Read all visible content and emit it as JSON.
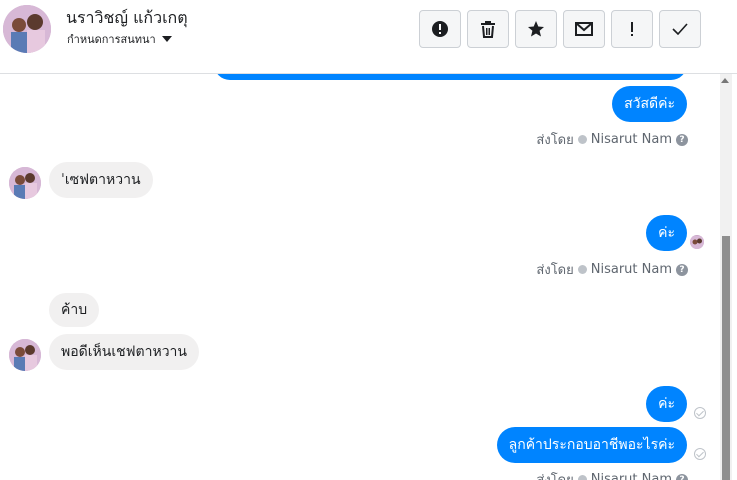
{
  "header": {
    "contact_name": "นราวิชญ์ แก้วเกตุ",
    "label_dropdown": "กำหนดการสนทนา"
  },
  "toolbar": {
    "buttons": [
      "report-icon",
      "trash-icon",
      "star-icon",
      "mail-icon",
      "exclamation-icon",
      "check-icon"
    ]
  },
  "messages": [
    {
      "direction": "out",
      "text": "สวัสดีค่ะ"
    },
    {
      "direction": "in",
      "text": "ˈเซฟตาหวาน"
    },
    {
      "direction": "out",
      "text": "ค่ะ"
    },
    {
      "direction": "in",
      "text": "ค้าบ"
    },
    {
      "direction": "in",
      "text": "พอดีเห็นเชฟตาหวาน"
    },
    {
      "direction": "out",
      "text": "ค่ะ"
    },
    {
      "direction": "out",
      "text": "ลูกค้าประกอบอาชีพอะไรค่ะ"
    }
  ],
  "sent_by": {
    "prefix": "ส่งโดย",
    "agent": "Nisarut Nam",
    "help": "?"
  },
  "colors": {
    "outgoing_bubble": "#0084ff",
    "incoming_bubble": "#f1f0f0"
  }
}
